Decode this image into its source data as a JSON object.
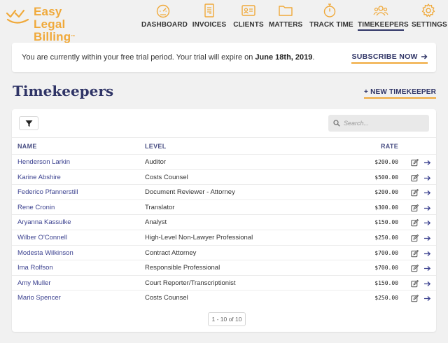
{
  "app": {
    "logo_line1": "Easy Legal",
    "logo_line2": "Billing",
    "logo_tm": "™",
    "brand_color": "#f0a93a",
    "accent_color": "#2f3466"
  },
  "nav": {
    "items": [
      {
        "label": "DASHBOARD",
        "icon": "gauge-icon"
      },
      {
        "label": "INVOICES",
        "icon": "invoice-icon"
      },
      {
        "label": "CLIENTS",
        "icon": "id-card-icon"
      },
      {
        "label": "MATTERS",
        "icon": "folder-icon"
      },
      {
        "label": "TRACK TIME",
        "icon": "stopwatch-icon"
      },
      {
        "label": "TIMEKEEPERS",
        "icon": "users-icon",
        "active": true
      },
      {
        "label": "SETTINGS",
        "icon": "gear-icon"
      }
    ]
  },
  "banner": {
    "text_before": "You are currently within your free trial period. Your trial will expire on ",
    "date": "June 18th, 2019",
    "text_after": ".",
    "subscribe_label": "SUBSCRIBE NOW",
    "subscribe_icon": "arrow-right-icon"
  },
  "page": {
    "title": "Timekeepers",
    "new_button_plus": "+",
    "new_button_label": "NEW TIMEKEEPER"
  },
  "toolbar": {
    "filter_icon": "filter-icon",
    "search_placeholder": "Search..."
  },
  "table": {
    "columns": {
      "name": "NAME",
      "level": "LEVEL",
      "rate": "RATE"
    },
    "rows": [
      {
        "name": "Henderson Larkin",
        "level": "Auditor",
        "rate": "$200.00"
      },
      {
        "name": "Karine Abshire",
        "level": "Costs Counsel",
        "rate": "$500.00"
      },
      {
        "name": "Federico Pfannerstill",
        "level": "Document Reviewer - Attorney",
        "rate": "$200.00"
      },
      {
        "name": "Rene Cronin",
        "level": "Translator",
        "rate": "$300.00"
      },
      {
        "name": "Aryanna Kassulke",
        "level": "Analyst",
        "rate": "$150.00"
      },
      {
        "name": "Wilber O'Connell",
        "level": "High-Level Non-Lawyer Professional",
        "rate": "$250.00"
      },
      {
        "name": "Modesta Wilkinson",
        "level": "Contract Attorney",
        "rate": "$700.00"
      },
      {
        "name": "Ima Rolfson",
        "level": "Responsible Professional",
        "rate": "$700.00"
      },
      {
        "name": "Amy Muller",
        "level": "Court Reporter/Transcriptionist",
        "rate": "$150.00"
      },
      {
        "name": "Mario Spencer",
        "level": "Costs Counsel",
        "rate": "$250.00"
      }
    ],
    "row_actions": {
      "edit_icon": "edit-icon",
      "open_icon": "arrow-right-icon"
    }
  },
  "pagination": {
    "label": "1 - 10 of 10"
  }
}
